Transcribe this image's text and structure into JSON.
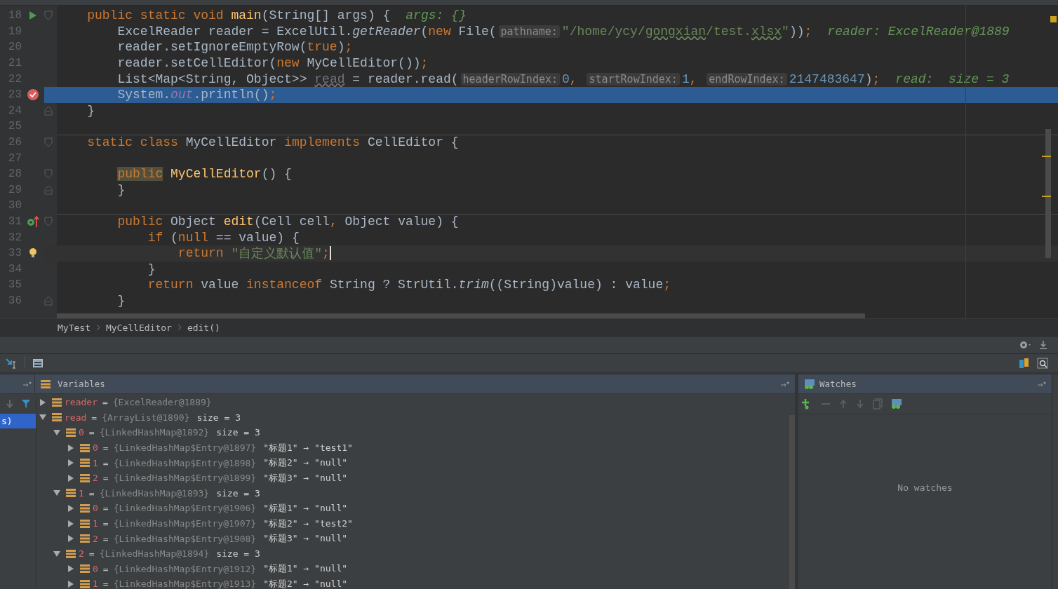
{
  "editor": {
    "lines": [
      {
        "number": "18",
        "gutter": {
          "kind": "run"
        },
        "fold": {
          "kind": "start"
        },
        "selected": false,
        "current": false,
        "separator": false,
        "tokens": [
          {
            "kind": "kw",
            "text": "    public static void "
          },
          {
            "kind": "method",
            "text": "main"
          },
          {
            "kind": "plain",
            "text": "(String[] args) {"
          },
          {
            "kind": "debug",
            "text": "args: {}"
          }
        ]
      },
      {
        "number": "19",
        "selected": false,
        "current": false,
        "separator": false,
        "tokens": [
          {
            "kind": "plain",
            "text": "        ExcelReader reader = ExcelUtil."
          },
          {
            "kind": "italic",
            "text": "getReader"
          },
          {
            "kind": "plain",
            "text": "("
          },
          {
            "kind": "kw",
            "text": "new "
          },
          {
            "kind": "plain",
            "text": "File("
          },
          {
            "kind": "hint",
            "text": "pathname:"
          },
          {
            "kind": "str",
            "text": "\"/home/ycy/"
          },
          {
            "kind": "strtypo",
            "text": "gongxian"
          },
          {
            "kind": "str",
            "text": "/test."
          },
          {
            "kind": "strtypo",
            "text": "xlsx"
          },
          {
            "kind": "str",
            "text": "\""
          },
          {
            "kind": "plain",
            "text": "))"
          },
          {
            "kind": "kw",
            "text": ";"
          },
          {
            "kind": "debug",
            "text": "reader: ExcelReader@1889"
          }
        ]
      },
      {
        "number": "20",
        "selected": false,
        "current": false,
        "separator": false,
        "tokens": [
          {
            "kind": "plain",
            "text": "        reader.setIgnoreEmptyRow("
          },
          {
            "kind": "kw",
            "text": "true"
          },
          {
            "kind": "plain",
            "text": ")"
          },
          {
            "kind": "kw",
            "text": ";"
          }
        ]
      },
      {
        "number": "21",
        "selected": false,
        "current": false,
        "separator": false,
        "tokens": [
          {
            "kind": "plain",
            "text": "        reader.setCellEditor("
          },
          {
            "kind": "kw",
            "text": "new "
          },
          {
            "kind": "plain",
            "text": "MyCellEditor())"
          },
          {
            "kind": "kw",
            "text": ";"
          }
        ]
      },
      {
        "number": "22",
        "selected": false,
        "current": false,
        "separator": false,
        "tokens": [
          {
            "kind": "plain",
            "text": "        List<Map<String, Object>> "
          },
          {
            "kind": "unused",
            "text": "read"
          },
          {
            "kind": "plain",
            "text": " = reader.read("
          },
          {
            "kind": "hint",
            "text": "headerRowIndex:"
          },
          {
            "kind": "num",
            "text": "0"
          },
          {
            "kind": "kw",
            "text": ", "
          },
          {
            "kind": "hint",
            "text": "startRowIndex:"
          },
          {
            "kind": "num",
            "text": "1"
          },
          {
            "kind": "kw",
            "text": ", "
          },
          {
            "kind": "hint",
            "text": "endRowIndex:"
          },
          {
            "kind": "num",
            "text": "2147483647"
          },
          {
            "kind": "plain",
            "text": ")"
          },
          {
            "kind": "kw",
            "text": ";"
          },
          {
            "kind": "debug",
            "text": "read:  size = 3"
          }
        ]
      },
      {
        "number": "23",
        "gutter": {
          "kind": "breakpoint"
        },
        "selected": true,
        "current": false,
        "separator": false,
        "tokens": [
          {
            "kind": "plain",
            "text": "        System."
          },
          {
            "kind": "field",
            "text": "out"
          },
          {
            "kind": "plain",
            "text": ".println()"
          },
          {
            "kind": "kw",
            "text": ";"
          }
        ]
      },
      {
        "number": "24",
        "fold": {
          "kind": "end"
        },
        "selected": false,
        "current": false,
        "separator": false,
        "tokens": [
          {
            "kind": "plain",
            "text": "    }"
          }
        ]
      },
      {
        "number": "25",
        "selected": false,
        "current": false,
        "separator": false
      },
      {
        "number": "26",
        "fold": {
          "kind": "start"
        },
        "selected": false,
        "current": false,
        "separator": true,
        "tokens": [
          {
            "kind": "kw",
            "text": "    static class "
          },
          {
            "kind": "plain",
            "text": "MyCellEditor "
          },
          {
            "kind": "kw",
            "text": "implements "
          },
          {
            "kind": "plain",
            "text": "CellEditor {"
          }
        ]
      },
      {
        "number": "27",
        "selected": false,
        "current": false,
        "separator": false
      },
      {
        "number": "28",
        "fold": {
          "kind": "start"
        },
        "selected": false,
        "current": false,
        "separator": false,
        "tokens": [
          {
            "kind": "kwmark",
            "text": "        public"
          },
          {
            "kind": "method",
            "text": " MyCellEditor"
          },
          {
            "kind": "plain",
            "text": "() {"
          }
        ]
      },
      {
        "number": "29",
        "fold": {
          "kind": "end"
        },
        "selected": false,
        "current": false,
        "separator": false,
        "tokens": [
          {
            "kind": "plain",
            "text": "        }"
          }
        ]
      },
      {
        "number": "30",
        "selected": false,
        "current": false,
        "separator": false
      },
      {
        "number": "31",
        "gutter": {
          "kind": "override"
        },
        "fold": {
          "kind": "start"
        },
        "selected": false,
        "current": false,
        "separator": true,
        "tokens": [
          {
            "kind": "kw",
            "text": "        public "
          },
          {
            "kind": "plain",
            "text": "Object "
          },
          {
            "kind": "method",
            "text": "edit"
          },
          {
            "kind": "plain",
            "text": "(Cell cell"
          },
          {
            "kind": "kw",
            "text": ", "
          },
          {
            "kind": "plain",
            "text": "Object value) {"
          }
        ]
      },
      {
        "number": "32",
        "selected": false,
        "current": false,
        "separator": false,
        "tokens": [
          {
            "kind": "kw",
            "text": "            if "
          },
          {
            "kind": "plain",
            "text": "("
          },
          {
            "kind": "kw",
            "text": "null "
          },
          {
            "kind": "plain",
            "text": "== value) {"
          }
        ]
      },
      {
        "number": "33",
        "gutter": {
          "kind": "bulb"
        },
        "selected": false,
        "current": true,
        "separator": false,
        "tokens": [
          {
            "kind": "kw",
            "text": "                return "
          },
          {
            "kind": "str",
            "text": "\"自定义默认值\""
          },
          {
            "kind": "kw",
            "text": ";"
          }
        ]
      },
      {
        "number": "34",
        "selected": false,
        "current": false,
        "separator": false,
        "tokens": [
          {
            "kind": "plain",
            "text": "            }"
          }
        ]
      },
      {
        "number": "35",
        "selected": false,
        "current": false,
        "separator": false,
        "tokens": [
          {
            "kind": "kw",
            "text": "            return "
          },
          {
            "kind": "plain",
            "text": "value "
          },
          {
            "kind": "kw",
            "text": "instanceof "
          },
          {
            "kind": "plain",
            "text": "String ? StrUtil."
          },
          {
            "kind": "italic",
            "text": "trim"
          },
          {
            "kind": "plain",
            "text": "((String)value) : value"
          },
          {
            "kind": "kw",
            "text": ";"
          }
        ]
      },
      {
        "number": "36",
        "fold": {
          "kind": "end"
        },
        "selected": false,
        "current": false,
        "separator": false,
        "tokens": [
          {
            "kind": "plain",
            "text": "        }"
          }
        ]
      }
    ]
  },
  "breadcrumbs": [
    "MyTest",
    "MyCellEditor",
    "edit()"
  ],
  "frames": [
    {
      "label": "s)",
      "selected": true
    }
  ],
  "variables": {
    "title": "Variables",
    "nodes": [
      {
        "name": "reader",
        "op": "=",
        "value": "{ExcelReader@1889}",
        "expanded": false
      },
      {
        "name": "read",
        "op": "=",
        "value": "{ArrayList@1890}",
        "info": "size = 3",
        "expanded": true,
        "children": [
          {
            "name": "0",
            "op": "=",
            "value": "{LinkedHashMap@1892}",
            "info": "size = 3",
            "expanded": true,
            "children": [
              {
                "name": "0",
                "op": "=",
                "value": "{LinkedHashMap$Entry@1897}",
                "info": "\"标题1\" → \"test1\"",
                "expanded": false
              },
              {
                "name": "1",
                "op": "=",
                "value": "{LinkedHashMap$Entry@1898}",
                "info": "\"标题2\" → \"null\"",
                "expanded": false
              },
              {
                "name": "2",
                "op": "=",
                "value": "{LinkedHashMap$Entry@1899}",
                "info": "\"标题3\" → \"null\"",
                "expanded": false
              }
            ]
          },
          {
            "name": "1",
            "op": "=",
            "value": "{LinkedHashMap@1893}",
            "info": "size = 3",
            "expanded": true,
            "children": [
              {
                "name": "0",
                "op": "=",
                "value": "{LinkedHashMap$Entry@1906}",
                "info": "\"标题1\" → \"null\"",
                "expanded": false
              },
              {
                "name": "1",
                "op": "=",
                "value": "{LinkedHashMap$Entry@1907}",
                "info": "\"标题2\" → \"test2\"",
                "expanded": false
              },
              {
                "name": "2",
                "op": "=",
                "value": "{LinkedHashMap$Entry@1908}",
                "info": "\"标题3\" → \"null\"",
                "expanded": false
              }
            ]
          },
          {
            "name": "2",
            "op": "=",
            "value": "{LinkedHashMap@1894}",
            "info": "size = 3",
            "expanded": true,
            "children": [
              {
                "name": "0",
                "op": "=",
                "value": "{LinkedHashMap$Entry@1912}",
                "info": "\"标题1\" → \"null\"",
                "expanded": false
              },
              {
                "name": "1",
                "op": "=",
                "value": "{LinkedHashMap$Entry@1913}",
                "info": "\"标题2\" → \"null\"",
                "expanded": false
              }
            ]
          }
        ]
      }
    ]
  },
  "watches": {
    "title": "Watches",
    "empty_text": "No watches"
  }
}
